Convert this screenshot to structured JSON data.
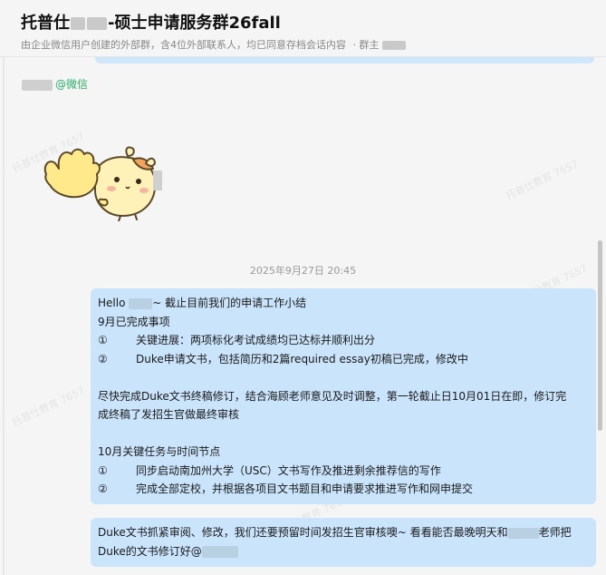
{
  "header": {
    "title_part1": "托普仕",
    "title_part2": "-硕士申请服务群26fall",
    "subtitle": "由企业微信用户创建的外部群，含4位外部联系人，均已同意存档会话内容",
    "owner_label": "· 群主"
  },
  "sender": {
    "badge": "@微信"
  },
  "timestamp": "2025年9月27日 20:45",
  "message1": {
    "greeting_pre": "Hello ",
    "greeting_post": "~ 截止目前我们的申请工作小结",
    "section1_title": "9月已完成事项",
    "section1_items": [
      {
        "num": "①",
        "text": "关键进展：两项标化考试成绩均已达标并顺利出分"
      },
      {
        "num": "②",
        "text": "Duke申请文书，包括简历和2篇required essay初稿已完成，修改中"
      }
    ],
    "para_line1": "尽快完成Duke文书终稿修订，结合海顾老师意见及时调整，第一轮截止日10月01日在即，修订完",
    "para_line2": "成终稿了发招生官做最终审核",
    "section2_title": "10月关键任务与时间节点",
    "section2_items": [
      {
        "num": "①",
        "text": "同步启动南加州大学（USC）文书写作及推进剩余推荐信的写作"
      },
      {
        "num": "②",
        "text": "完成全部定校，并根据各项目文书题目和申请要求推进写作和网申提交"
      }
    ]
  },
  "message2": {
    "line1_pre": "Duke文书抓紧审阅、修改，我们还要预留时间发招生官审核噢~ 看看能否最晚明天和",
    "line1_post": "老师把",
    "line2_pre": "Duke的文书修订好@"
  },
  "watermark": "托普仕教育 7657",
  "colors": {
    "bubble": "#c9e4fb",
    "badge_green": "#2aae67",
    "background": "#f5f5f5"
  }
}
